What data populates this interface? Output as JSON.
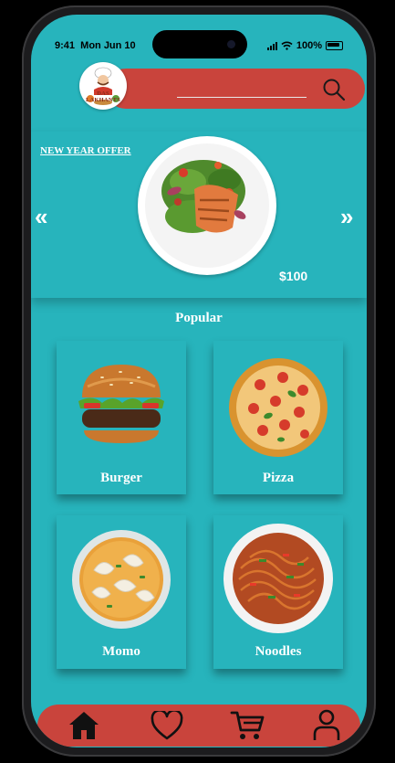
{
  "status_bar": {
    "time": "9:41",
    "date": "Mon Jun 10",
    "battery": "100%"
  },
  "header": {
    "logo_text": "DAS LAKHANTS",
    "search_icon": "search-icon"
  },
  "offer": {
    "label": "NEW YEAR OFFER",
    "price": "$100",
    "prev_arrow": "«",
    "next_arrow": "»"
  },
  "popular": {
    "title": "Popular",
    "items": [
      {
        "label": "Burger"
      },
      {
        "label": "Pizza"
      },
      {
        "label": "Momo"
      },
      {
        "label": "Noodles"
      }
    ]
  },
  "bottom_nav": {
    "items": [
      "home-icon",
      "heart-icon",
      "cart-icon",
      "user-icon"
    ]
  },
  "colors": {
    "background": "#27b4bc",
    "accent": "#c9443c",
    "text": "#ffffff"
  }
}
